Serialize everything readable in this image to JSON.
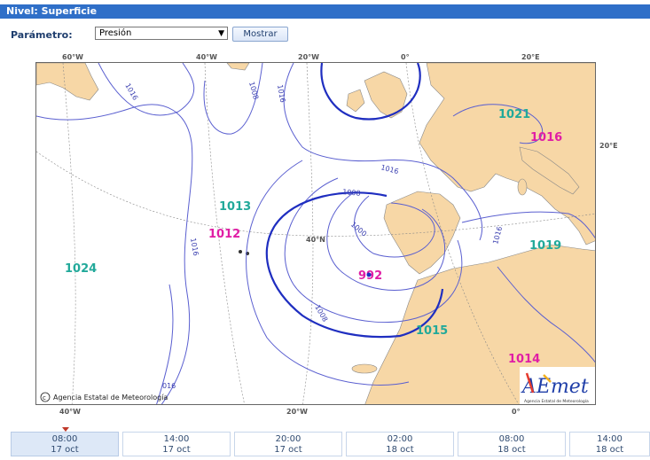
{
  "header": {
    "title": "Nivel: Superficie"
  },
  "controls": {
    "parameter_label": "Parámetro:",
    "parameter_value": "Presión",
    "show_button": "Mostrar"
  },
  "map": {
    "top_coords": [
      "60°W",
      "40°W",
      "20°W",
      "0°",
      "20°E"
    ],
    "bottom_coords": [
      "40°W",
      "20°W",
      "0°"
    ],
    "side_coords": [
      "20°E",
      "40°N"
    ],
    "pressure_labels": {
      "teal": [
        "1021",
        "1013",
        "1024",
        "1019",
        "1015"
      ],
      "magenta": [
        "1016",
        "1012",
        "992",
        "1014"
      ]
    },
    "isobar_labels": [
      "1016",
      "1008",
      "1016",
      "1016",
      "1008",
      "1000",
      "1016",
      "1008",
      "1016",
      "016"
    ],
    "copyright": "Agencia Estatal de Meteorología",
    "logo_text": "AEmet",
    "logo_sub": "Agencia Estatal de Meteorología",
    "colors": {
      "land": "#f7d7a6",
      "isobar": "#5a5fd0",
      "isobar_bold": "#1f2ec0",
      "high": "#22a99a",
      "low": "#e01ea5"
    }
  },
  "timeline": {
    "slots": [
      {
        "time": "08:00",
        "date": "17 oct"
      },
      {
        "time": "14:00",
        "date": "17 oct"
      },
      {
        "time": "20:00",
        "date": "17 oct"
      },
      {
        "time": "02:00",
        "date": "18 oct"
      },
      {
        "time": "08:00",
        "date": "18 oct"
      },
      {
        "time": "14:00",
        "date": "18 oct"
      }
    ]
  }
}
